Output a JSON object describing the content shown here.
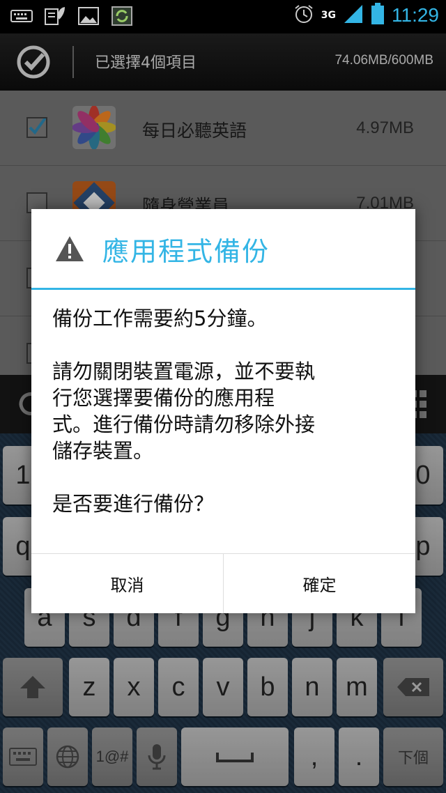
{
  "status_bar": {
    "time": "11:29",
    "network": "3G",
    "icons": [
      "keyboard-icon",
      "clipboard-leaf-icon",
      "image-icon",
      "sync-icon",
      "alarm-icon",
      "signal-icon",
      "battery-icon"
    ]
  },
  "action_bar": {
    "title": "已選擇4個項目",
    "storage": "74.06MB/600MB"
  },
  "list": [
    {
      "name": "每日必聽英語",
      "size": "4.97MB",
      "checked": true
    },
    {
      "name": "隨身營業員",
      "size": "7.01MB",
      "checked": false
    }
  ],
  "dialog": {
    "title": "應用程式備份",
    "para1": "備份工作需要約5分鐘。",
    "para2": "請勿關閉裝置電源，並不要執\n行您選擇要備份的應用程\n式。進行備份時請勿移除外接\n儲存裝置。",
    "para3": "是否要進行備份？",
    "cancel": "取消",
    "confirm": "確定"
  },
  "keyboard": {
    "row1_left": "1",
    "row1_right": "0",
    "row2_left": "q",
    "row2_right": "p",
    "row3": [
      "a",
      "s",
      "d",
      "f",
      "g",
      "h",
      "j",
      "k",
      "l"
    ],
    "row4": [
      "z",
      "x",
      "c",
      "v",
      "b",
      "n",
      "m"
    ],
    "symbols": "1@#",
    "dot": ".",
    "next": "下個"
  },
  "colors": {
    "accent": "#33b5e5"
  }
}
